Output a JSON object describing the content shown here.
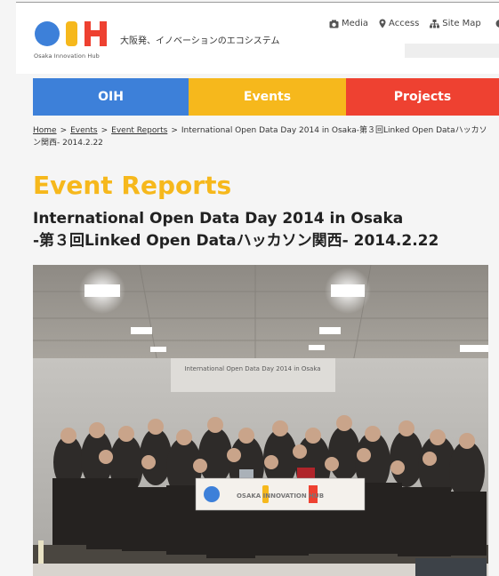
{
  "header": {
    "logo_text": "Osaka Innovation Hub",
    "tagline": "大阪発、イノベーションのエコシステム",
    "links": [
      {
        "label": "Media",
        "icon": "camera-icon"
      },
      {
        "label": "Access",
        "icon": "map-pin-icon"
      },
      {
        "label": "Site Map",
        "icon": "sitemap-icon"
      }
    ]
  },
  "nav": {
    "tabs": [
      {
        "label": "OIH",
        "color": "#3d80d9"
      },
      {
        "label": "Events",
        "color": "#f6b81c"
      },
      {
        "label": "Projects",
        "color": "#ee4131"
      }
    ]
  },
  "breadcrumb": {
    "items": [
      "Home",
      "Events",
      "Event Reports"
    ],
    "separator": ">",
    "current": "International Open Data Day 2014 in Osaka-第３回Linked Open Dataハッカソン関西- 2014.2.22"
  },
  "page": {
    "section_title": "Event Reports",
    "title_line1": "International Open Data Day 2014 in Osaka",
    "title_line2": "-第３回Linked Open Dataハッカソン関西- 2014.2.22"
  },
  "photo": {
    "banner_text": "International Open Data Day 2014 in Osaka",
    "sign_text": "OSAKA INNOVATION HUB"
  },
  "colors": {
    "blue": "#3d80d9",
    "yellow": "#f6b81c",
    "red": "#ee4131"
  }
}
